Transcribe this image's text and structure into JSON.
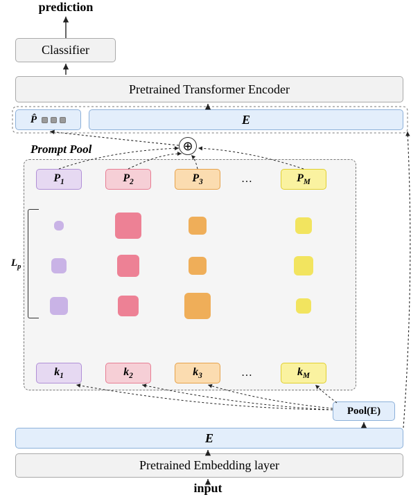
{
  "labels": {
    "prediction": "prediction",
    "input": "input",
    "classifier": "Classifier",
    "encoder": "Pretrained Transformer Encoder",
    "embedding": "Pretrained Embedding layer",
    "phat": "P̂",
    "E": "E",
    "poolE": "Pool(E)",
    "prompt_pool_title": "Prompt Pool",
    "Lp": "L",
    "Lp_sub": "p",
    "dots": "…"
  },
  "prompts": {
    "columns": [
      {
        "id": "1",
        "p": "P",
        "k": "k",
        "color": "purple"
      },
      {
        "id": "2",
        "p": "P",
        "k": "k",
        "color": "pink"
      },
      {
        "id": "3",
        "p": "P",
        "k": "k",
        "color": "orange"
      },
      {
        "id": "M",
        "p": "P",
        "k": "k",
        "color": "yellow"
      }
    ],
    "token_sizes": [
      [
        14,
        38,
        26,
        24
      ],
      [
        22,
        32,
        26,
        28
      ],
      [
        26,
        30,
        38,
        22
      ]
    ]
  },
  "colors": {
    "purple": "#c9b3e6",
    "pink": "#ed8195",
    "orange": "#efae59",
    "yellow": "#f2e45f",
    "block_fill": "#f2f2f2",
    "block_border": "#a9a9a9",
    "blue_fill": "#e3eefb",
    "blue_border": "#8cb0d9"
  }
}
